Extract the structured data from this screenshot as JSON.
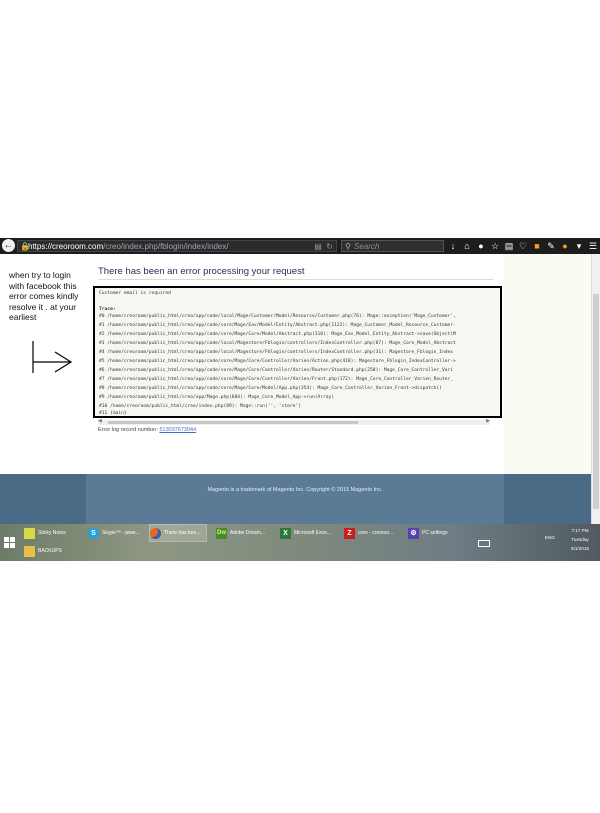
{
  "browser": {
    "url_host": "https://creoroom.com",
    "url_path": "/creo/index.php/fblogin/index/index/",
    "search_placeholder": "Search"
  },
  "annotation": {
    "note": "when try to login with facebook this error comes kindly resolve it . at your earliest"
  },
  "page": {
    "error_title": "There has been an error processing your request",
    "message": "Customer email is required",
    "trace_label": "Trace:",
    "trace_lines": [
      "#0 /home/creoroom/public_html/creo/app/code/local/Mage/Customer/Model/Resource/Customer.php(76): Mage::exception('Mage_Customer',",
      "#1 /home/creoroom/public_html/creo/app/code/core/Mage/Eav/Model/Entity/Abstract.php(1122): Mage_Customer_Model_Resource_Customer-",
      "#2 /home/creoroom/public_html/creo/app/code/core/Mage/Core/Model/Abstract.php(318): Mage_Eav_Model_Entity_Abstract->save(Object(M",
      "#3 /home/creoroom/public_html/creo/app/code/local/Magestore/Fblogin/controllers/IndexController.php(87): Mage_Core_Model_Abstract",
      "#4 /home/creoroom/public_html/creo/app/code/local/Magestore/Fblogin/controllers/IndexController.php(31): Magestore_Fblogin_Index",
      "#5 /home/creoroom/public_html/creo/app/code/core/Mage/Core/Controller/Varien/Action.php(418): Magestore_Fblogin_IndexController->",
      "#6 /home/creoroom/public_html/creo/app/code/core/Mage/Core/Controller/Varien/Router/Standard.php(250): Mage_Core_Controller_Vari",
      "#7 /home/creoroom/public_html/creo/app/code/core/Mage/Core/Controller/Varien/Front.php(172): Mage_Core_Controller_Varien_Router_",
      "#8 /home/creoroom/public_html/creo/app/code/core/Mage/Core/Model/App.php(354): Mage_Core_Controller_Varien_Front->dispatch()",
      "#9 /home/creoroom/public_html/creo/app/Mage.php(684): Mage_Core_Model_App->run(Array)",
      "#10 /home/creoroom/public_html/creo/index.php(89): Mage::run('', 'store')",
      "#11 {main}"
    ],
    "log_label": "Error log record number:",
    "log_number": "513037673044",
    "footer": "Magento is a trademark of Magento Inc. Copyright © 2015 Magento Inc."
  },
  "taskbar": {
    "items": [
      {
        "label": "Sticky Notes",
        "icon": "sticky-notes-icon"
      },
      {
        "label": "Skype™ - jewe...",
        "icon": "skype-icon"
      },
      {
        "label": "There has bee...",
        "icon": "firefox-icon"
      },
      {
        "label": "Adobe Dream...",
        "icon": "dreamweaver-icon"
      },
      {
        "label": "Microsoft Exce...",
        "icon": "excel-icon"
      },
      {
        "label": "creo - creoroo...",
        "icon": "filezilla-icon"
      },
      {
        "label": "PC settings",
        "icon": "settings-icon"
      },
      {
        "label": "BACKUPS",
        "icon": "folder-icon"
      }
    ],
    "lang": "ENG",
    "time": "7:17 PM",
    "day": "Tuesday",
    "date": "9/1/2015"
  }
}
